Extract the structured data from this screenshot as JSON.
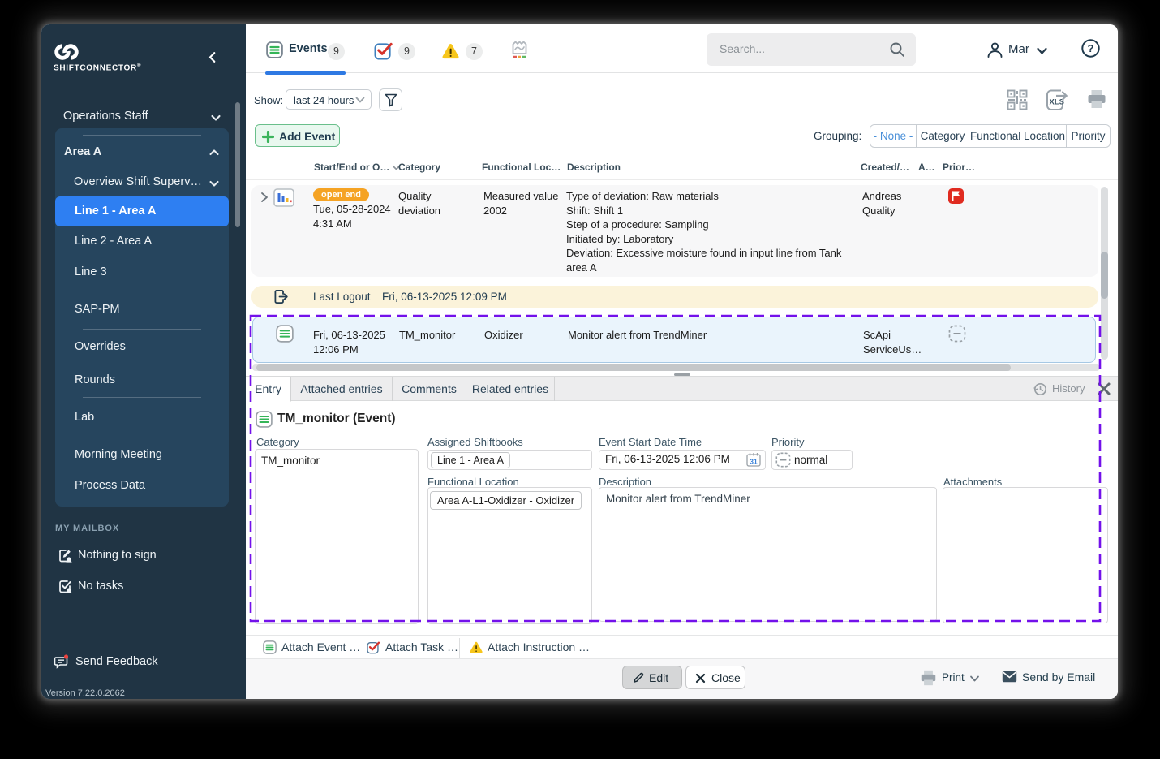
{
  "sidebar": {
    "brand": "SHIFTCONNECTOR",
    "reg_mark": "®",
    "items": {
      "operations": "Operations Staff",
      "area": "Area A",
      "overview": "Overview Shift Superv…",
      "line1": "Line 1 - Area A",
      "line2": "Line 2 - Area A",
      "line3": "Line 3",
      "sap_pm": "SAP-PM",
      "overrides": "Overrides",
      "rounds": "Rounds",
      "lab": "Lab",
      "morning_meeting": "Morning Meeting",
      "process_data": "Process Data"
    },
    "mailbox": {
      "title": "MY MAILBOX",
      "nothing_to_sign": "Nothing to sign",
      "no_tasks": "No tasks"
    },
    "send_feedback": "Send Feedback",
    "version": "Version 7.22.0.2062"
  },
  "topbar": {
    "events_label": "Events",
    "events_count": "9",
    "tasks_count": "9",
    "warnings_count": "7",
    "search_placeholder": "Search...",
    "user_name": "Mar"
  },
  "toolbar": {
    "show_label": "Show:",
    "show_value": "last 24 hours",
    "add_event": "Add Event",
    "grouping_label": "Grouping:",
    "grouping_none": "- None -",
    "grouping_category": "Category",
    "grouping_functional": "Functional Location",
    "grouping_priority": "Priority"
  },
  "table": {
    "columns": {
      "start": "Start/End or O…",
      "category": "Category",
      "functional": "Functional Loc…",
      "description": "Description",
      "created": "Created/…",
      "attachments": "A…",
      "priority": "Prior…"
    },
    "row1": {
      "status": "open end",
      "date": "Tue, 05-28-2024",
      "time": "4:31 AM",
      "category": "Quality deviation",
      "functional": "Measured value 2002",
      "description": "Type of deviation: Raw materials\nShift: Shift 1\nStep of a procedure: Sampling\nInitiated by: Laboratory\nDeviation: Excessive moisture found in input line from Tank area A",
      "created": "Andreas Quality"
    },
    "logout_row": {
      "label": "Last Logout",
      "datetime": "Fri, 06-13-2025 12:09 PM"
    },
    "selected_row": {
      "date": "Fri, 06-13-2025",
      "time": "12:06 PM",
      "category": "TM_monitor",
      "functional": "Oxidizer",
      "description": "Monitor alert from TrendMiner",
      "created": "ScApi ServiceUs…"
    }
  },
  "panel": {
    "tabs": {
      "entry": "Entry",
      "attached": "Attached entries",
      "comments": "Comments",
      "related": "Related entries"
    },
    "history": "History",
    "title": "TM_monitor (Event)",
    "category_label": "Category",
    "category_value": "TM_monitor",
    "shiftbooks_label": "Assigned Shiftbooks",
    "shiftbooks_value": "Line 1 - Area A",
    "start_label": "Event Start Date Time",
    "start_value": "Fri, 06-13-2025 12:06 PM",
    "calendar_day": "31",
    "priority_label": "Priority",
    "priority_value": "normal",
    "functional_label": "Functional Location",
    "functional_value": "Area A-L1-Oxidizer - Oxidizer",
    "description_label": "Description",
    "description_value": "Monitor alert from TrendMiner",
    "attachments_label": "Attachments",
    "attach_event": "Attach Event …",
    "attach_task": "Attach Task …",
    "attach_instruction": "Attach Instruction …"
  },
  "footer": {
    "edit": "Edit",
    "close": "Close",
    "print": "Print",
    "send_by_email": "Send by Email"
  },
  "colors": {
    "accent_blue": "#2e7ff2",
    "accent_green": "#35b558",
    "warning_yellow": "#f7c61b",
    "danger_red": "#e02b20",
    "open_end_orange": "#f5a324",
    "highlight_purple": "#7311ea"
  }
}
